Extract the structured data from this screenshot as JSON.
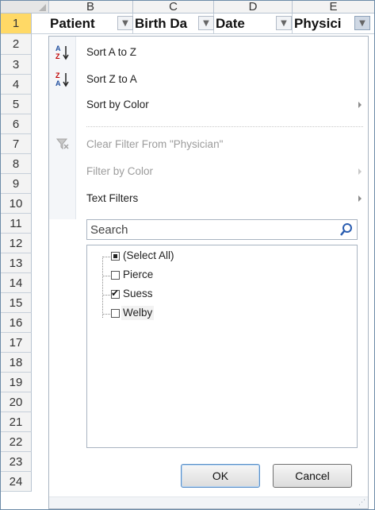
{
  "columns": [
    "B",
    "C",
    "D",
    "E"
  ],
  "rows": [
    "1",
    "2",
    "3",
    "4",
    "5",
    "6",
    "7",
    "8",
    "9",
    "10",
    "11",
    "12",
    "13",
    "14",
    "15",
    "16",
    "17",
    "18",
    "19",
    "20",
    "21",
    "22",
    "23",
    "24"
  ],
  "header_cells": {
    "patient": "Patient",
    "birth_date": "Birth Da",
    "date": "Date",
    "physician": "Physici"
  },
  "menu": {
    "sort_az": "Sort A to Z",
    "sort_za": "Sort Z to A",
    "sort_by_color": "Sort by Color",
    "clear_filter": "Clear Filter From \"Physician\"",
    "filter_by_color": "Filter by Color",
    "text_filters": "Text Filters"
  },
  "search": {
    "placeholder": "Search"
  },
  "filter_items": [
    {
      "label": "(Select All)",
      "state": "partial"
    },
    {
      "label": "Pierce",
      "state": "unchecked"
    },
    {
      "label": "Suess",
      "state": "checked"
    },
    {
      "label": "Welby",
      "state": "unchecked"
    }
  ],
  "buttons": {
    "ok": "OK",
    "cancel": "Cancel"
  },
  "icons": {
    "sort_az": "sort-ascending-icon",
    "sort_za": "sort-descending-icon",
    "clear_filter": "clear-filter-funnel-icon",
    "search": "magnifier-icon",
    "dropdown": "chevron-down-icon"
  },
  "colors": {
    "active_row": "#ffd966",
    "dropdown_active": "#cfd8e4",
    "ok_focus": "#5a8fc7"
  }
}
